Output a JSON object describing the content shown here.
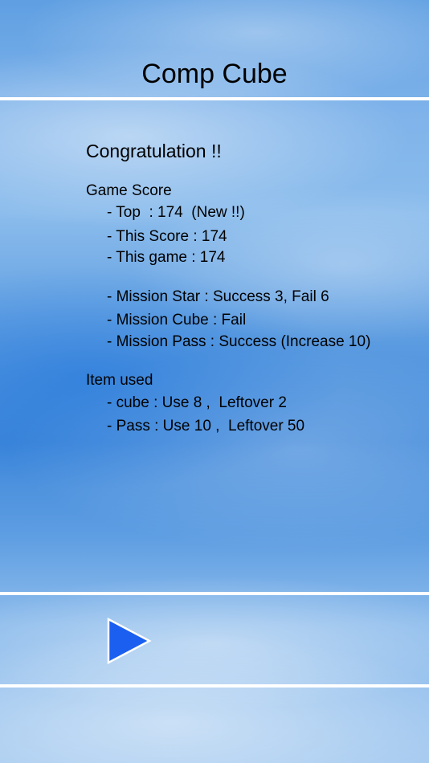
{
  "header": {
    "title": "Comp Cube"
  },
  "result": {
    "congrats": "Congratulation !!",
    "game_score_heading": "Game Score",
    "top_line": "- Top  : 174  (New !!)",
    "this_score_line": "- This Score : 174",
    "this_game_line": "- This game : 174",
    "mission_star_line": "- Mission Star : Success 3, Fail 6",
    "mission_cube_line": "- Mission Cube : Fail",
    "mission_pass_line": "- Mission Pass : Success (Increase 10)",
    "item_used_heading": "Item used",
    "cube_line": "- cube : Use 8 ,  Leftover 2",
    "pass_line": "- Pass : Use 10 ,  Leftover 50"
  },
  "controls": {
    "play_icon": "play-triangle-icon",
    "play_color": "#1a5ff0"
  }
}
